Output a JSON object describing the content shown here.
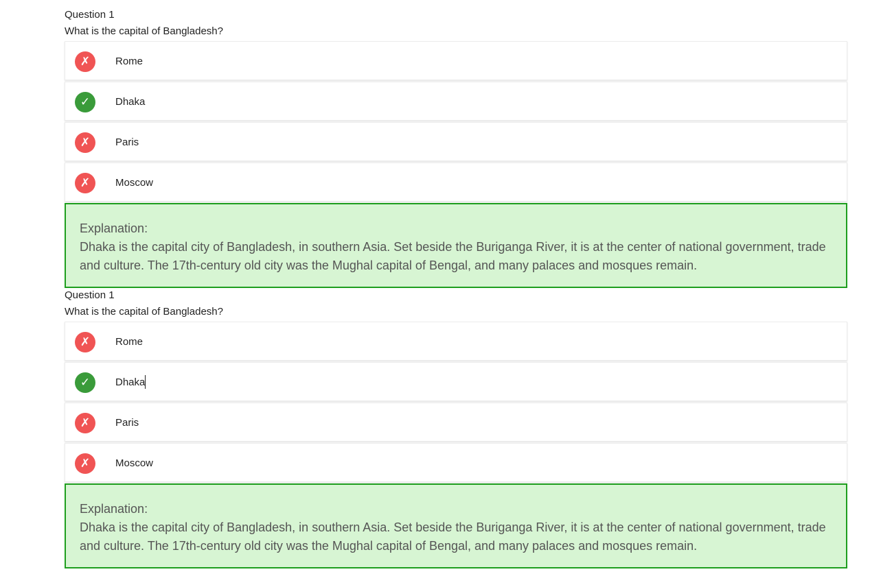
{
  "questions": [
    {
      "number": "Question 1",
      "text": "What is the capital of Bangladesh?",
      "options": [
        {
          "label": "Rome",
          "state": "wrong",
          "icon": "x-mark-icon",
          "glyph": "✗"
        },
        {
          "label": "Dhaka",
          "state": "correct",
          "icon": "check-mark-icon",
          "glyph": "✓"
        },
        {
          "label": "Paris",
          "state": "wrong",
          "icon": "x-mark-icon",
          "glyph": "✗"
        },
        {
          "label": "Moscow",
          "state": "wrong",
          "icon": "x-mark-icon",
          "glyph": "✗"
        }
      ],
      "explanation": {
        "title": "Explanation:",
        "body": "Dhaka is the capital city of Bangladesh, in southern Asia. Set beside the Buriganga River, it is at the center of national government, trade and culture. The 17th-century old city was the Mughal capital of Bengal, and many palaces and mosques remain."
      }
    },
    {
      "number": "Question 1",
      "text": "What is the capital of Bangladesh?",
      "options": [
        {
          "label": "Rome",
          "state": "wrong",
          "icon": "x-mark-icon",
          "glyph": "✗"
        },
        {
          "label": "Dhaka",
          "state": "correct",
          "icon": "check-mark-icon",
          "glyph": "✓"
        },
        {
          "label": "Paris",
          "state": "wrong",
          "icon": "x-mark-icon",
          "glyph": "✗"
        },
        {
          "label": "Moscow",
          "state": "wrong",
          "icon": "x-mark-icon",
          "glyph": "✗"
        }
      ],
      "explanation": {
        "title": "Explanation:",
        "body": "Dhaka is the capital city of Bangladesh, in southern Asia. Set beside the Buriganga River, it is at the center of national government, trade and culture. The 17th-century old city was the Mughal capital of Bengal, and many palaces and mosques remain."
      }
    }
  ],
  "colors": {
    "wrong": "#f05454",
    "correct": "#3a9b3a",
    "explanation_bg": "#d7f5d3",
    "explanation_border": "#1e9e1e"
  }
}
